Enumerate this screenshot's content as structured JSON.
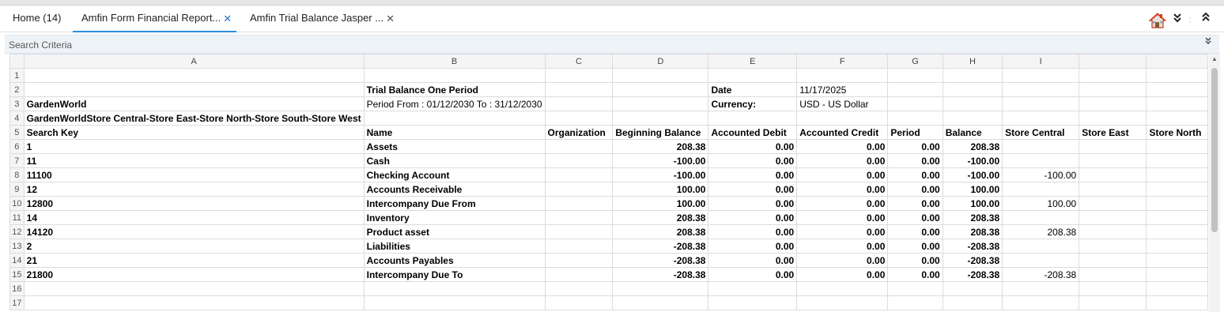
{
  "tabs": [
    {
      "label": "Home (14)",
      "closable": false,
      "active": false
    },
    {
      "label": "Amfin Form Financial Report...",
      "closable": true,
      "active": true
    },
    {
      "label": "Amfin Trial Balance Jasper ...",
      "closable": true,
      "active": false
    }
  ],
  "toolbar": {
    "icons": [
      "home-icon",
      "collapse-all-icon",
      "separator-icon",
      "expand-up-icon"
    ],
    "separator": ":"
  },
  "search_criteria": {
    "label": "Search Criteria",
    "toggle_icon": "chevron-double-down-icon"
  },
  "sheet": {
    "columns": [
      "A",
      "B",
      "C",
      "D",
      "E",
      "F",
      "G",
      "H",
      "I",
      ""
    ],
    "rows": [
      {
        "n": "1",
        "cells": [
          "",
          "",
          "",
          "",
          "",
          "",
          "",
          "",
          "",
          ""
        ]
      },
      {
        "n": "2",
        "cells": [
          "",
          "Trial Balance One Period",
          "",
          "",
          "Date",
          "11/17/2025",
          "",
          "",
          "",
          ""
        ]
      },
      {
        "n": "3",
        "cells": [
          "GardenWorld",
          "Period From  : 01/12/2030 To  : 31/12/2030",
          "",
          "",
          "Currency:",
          "USD - US Dollar",
          "",
          "",
          "",
          ""
        ]
      },
      {
        "n": "4",
        "cells": [
          "GardenWorldStore Central-Store East-Store North-Store South-Store West",
          "",
          "",
          "",
          "",
          "",
          "",
          "",
          "",
          ""
        ]
      },
      {
        "n": "5",
        "cells": [
          "Search Key",
          "Name",
          "Organization",
          "Beginning Balance",
          "Accounted Debit",
          "Accounted Credit",
          "Period",
          "Balance",
          "Store Central",
          "Store East",
          "Store North"
        ]
      },
      {
        "n": "6",
        "cells": [
          "1",
          "Assets",
          "",
          "208.38",
          "0.00",
          "0.00",
          "0.00",
          "208.38",
          "",
          "",
          ""
        ]
      },
      {
        "n": "7",
        "cells": [
          "11",
          "Cash",
          "",
          "-100.00",
          "0.00",
          "0.00",
          "0.00",
          "-100.00",
          "",
          "",
          ""
        ]
      },
      {
        "n": "8",
        "cells": [
          "11100",
          "Checking Account",
          "",
          "-100.00",
          "0.00",
          "0.00",
          "0.00",
          "-100.00",
          "-100.00",
          "",
          ""
        ]
      },
      {
        "n": "9",
        "cells": [
          "12",
          "Accounts Receivable",
          "",
          "100.00",
          "0.00",
          "0.00",
          "0.00",
          "100.00",
          "",
          "",
          ""
        ]
      },
      {
        "n": "10",
        "cells": [
          "12800",
          "Intercompany Due From",
          "",
          "100.00",
          "0.00",
          "0.00",
          "0.00",
          "100.00",
          "100.00",
          "",
          ""
        ]
      },
      {
        "n": "11",
        "cells": [
          "14",
          "Inventory",
          "",
          "208.38",
          "0.00",
          "0.00",
          "0.00",
          "208.38",
          "",
          "",
          ""
        ]
      },
      {
        "n": "12",
        "cells": [
          "14120",
          "Product asset",
          "",
          "208.38",
          "0.00",
          "0.00",
          "0.00",
          "208.38",
          "208.38",
          "",
          ""
        ]
      },
      {
        "n": "13",
        "cells": [
          "2",
          "Liabilities",
          "",
          "-208.38",
          "0.00",
          "0.00",
          "0.00",
          "-208.38",
          "",
          "",
          ""
        ]
      },
      {
        "n": "14",
        "cells": [
          "21",
          "Accounts Payables",
          "",
          "-208.38",
          "0.00",
          "0.00",
          "0.00",
          "-208.38",
          "",
          "",
          ""
        ]
      },
      {
        "n": "15",
        "cells": [
          "21800",
          "Intercompany Due To",
          "",
          "-208.38",
          "0.00",
          "0.00",
          "0.00",
          "-208.38",
          "-208.38",
          "",
          ""
        ]
      },
      {
        "n": "16",
        "cells": [
          "",
          "",
          "",
          "",
          "",
          "",
          "",
          "",
          "",
          "",
          ""
        ]
      },
      {
        "n": "17",
        "cells": [
          "",
          "",
          "",
          "",
          "",
          "",
          "",
          "",
          "",
          "",
          ""
        ]
      }
    ]
  },
  "colors": {
    "accent": "#2a8ddb",
    "negative": "#e00000",
    "header_bg": "#f5f5f5",
    "grid_line": "#dcdcdc"
  }
}
